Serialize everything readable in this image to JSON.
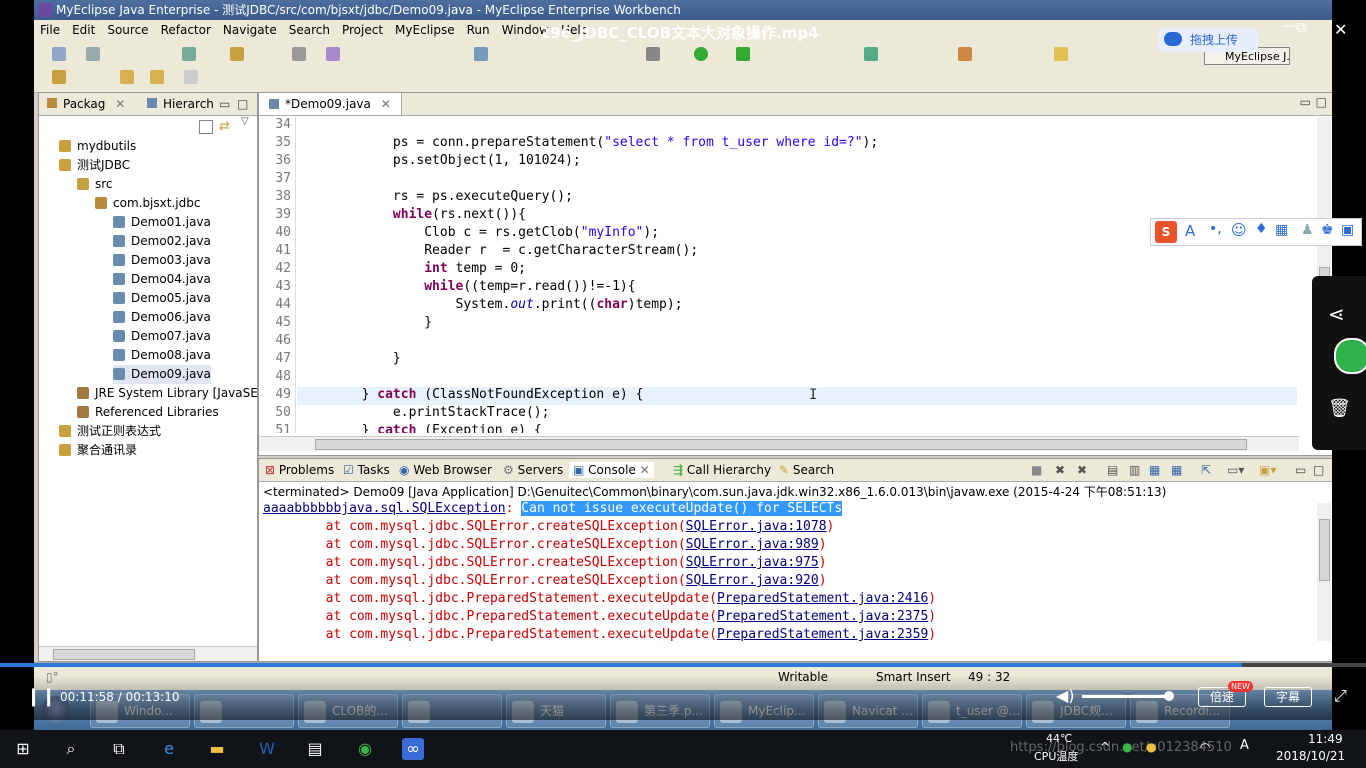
{
  "video": {
    "title": "296_JDBC_CLOB文本大对象操作.mp4",
    "upload_label": "拖拽上传",
    "current_time": "00:11:58",
    "total_time": "00:13:10",
    "time_separator": " / ",
    "progress": 0.909,
    "speed_label": "倍速",
    "speed_badge": "NEW",
    "subtitle_label": "字幕"
  },
  "ide": {
    "window_title": "MyEclipse Java Enterprise - 测试JDBC/src/com/bjsxt/jdbc/Demo09.java - MyEclipse Enterprise Workbench",
    "menus": [
      "File",
      "Edit",
      "Source",
      "Refactor",
      "Navigate",
      "Search",
      "Project",
      "MyEclipse",
      "Run",
      "Window",
      "Help"
    ],
    "perspective_label": "MyEclipse J...",
    "package_explorer": {
      "tab1": "Packag",
      "tab2": "Hierarch",
      "items": [
        {
          "label": "mydbutils",
          "level": 0,
          "icon": "project"
        },
        {
          "label": "测试JDBC",
          "level": 0,
          "icon": "project"
        },
        {
          "label": "src",
          "level": 1,
          "icon": "folder"
        },
        {
          "label": "com.bjsxt.jdbc",
          "level": 2,
          "icon": "package"
        },
        {
          "label": "Demo01.java",
          "level": 3,
          "icon": "java"
        },
        {
          "label": "Demo02.java",
          "level": 3,
          "icon": "java"
        },
        {
          "label": "Demo03.java",
          "level": 3,
          "icon": "java"
        },
        {
          "label": "Demo04.java",
          "level": 3,
          "icon": "java"
        },
        {
          "label": "Demo05.java",
          "level": 3,
          "icon": "java"
        },
        {
          "label": "Demo06.java",
          "level": 3,
          "icon": "java"
        },
        {
          "label": "Demo07.java",
          "level": 3,
          "icon": "java"
        },
        {
          "label": "Demo08.java",
          "level": 3,
          "icon": "java"
        },
        {
          "label": "Demo09.java",
          "level": 3,
          "icon": "java",
          "selected": true
        },
        {
          "label": "JRE System Library [JavaSE-",
          "level": 1,
          "icon": "library"
        },
        {
          "label": "Referenced Libraries",
          "level": 1,
          "icon": "library"
        },
        {
          "label": "测试正则表达式",
          "level": 0,
          "icon": "project"
        },
        {
          "label": "聚合通讯录",
          "level": 0,
          "icon": "project"
        }
      ]
    },
    "editor": {
      "tab_label": "*Demo09.java",
      "lines": [
        {
          "n": "34",
          "code": ""
        },
        {
          "n": "35",
          "code": "            ps = conn.prepareStatement(\"select * from t_user where id=?\");"
        },
        {
          "n": "36",
          "code": "            ps.setObject(1, 101024);"
        },
        {
          "n": "37",
          "code": ""
        },
        {
          "n": "38",
          "code": "            rs = ps.executeQuery();"
        },
        {
          "n": "39",
          "code": "            while(rs.next()){"
        },
        {
          "n": "40",
          "code": "                Clob c = rs.getClob(\"myInfo\");"
        },
        {
          "n": "41",
          "code": "                Reader r  = c.getCharacterStream();"
        },
        {
          "n": "42",
          "code": "                int temp = 0;"
        },
        {
          "n": "43",
          "code": "                while((temp=r.read())!=-1){"
        },
        {
          "n": "44",
          "code": "                    System.out.print((char)temp);"
        },
        {
          "n": "45",
          "code": "                }"
        },
        {
          "n": "46",
          "code": ""
        },
        {
          "n": "47",
          "code": "            }"
        },
        {
          "n": "48",
          "code": ""
        },
        {
          "n": "49",
          "code": "        } catch (ClassNotFoundException e) {"
        },
        {
          "n": "50",
          "code": "            e.printStackTrace();"
        },
        {
          "n": "51",
          "code": "        } catch (Exception e) {"
        }
      ]
    },
    "console": {
      "tabs": [
        "Problems",
        "Tasks",
        "Web Browser",
        "Servers",
        "Console",
        "Call Hierarchy",
        "Search"
      ],
      "status": "<terminated> Demo09 [Java Application] D:\\Genuitec\\Common\\binary\\com.sun.java.jdk.win32.x86_1.6.0.013\\bin\\javaw.exe (2015-4-24 下午08:51:13)",
      "exception_prefix": "aaaabbbbbbjava.sql.SQLException",
      "exception_sep": ": ",
      "exception_msg": "Can not issue executeUpdate() for SELECTs",
      "trace": [
        {
          "at": "        at com.mysql.jdbc.SQLError.createSQLException(",
          "link": "SQLError.java:1078",
          "end": ")"
        },
        {
          "at": "        at com.mysql.jdbc.SQLError.createSQLException(",
          "link": "SQLError.java:989",
          "end": ")"
        },
        {
          "at": "        at com.mysql.jdbc.SQLError.createSQLException(",
          "link": "SQLError.java:975",
          "end": ")"
        },
        {
          "at": "        at com.mysql.jdbc.SQLError.createSQLException(",
          "link": "SQLError.java:920",
          "end": ")"
        },
        {
          "at": "        at com.mysql.jdbc.PreparedStatement.executeUpdate(",
          "link": "PreparedStatement.java:2416",
          "end": ")"
        },
        {
          "at": "        at com.mysql.jdbc.PreparedStatement.executeUpdate(",
          "link": "PreparedStatement.java:2375",
          "end": ")"
        },
        {
          "at": "        at com.mysql.jdbc.PreparedStatement.executeUpdate(",
          "link": "PreparedStatement.java:2359",
          "end": ")"
        }
      ]
    },
    "statusbar": {
      "writable": "Writable",
      "insert_mode": "Smart Insert",
      "position": "49 : 32"
    }
  },
  "win7_taskbar": [
    {
      "label": "Windo..."
    },
    {
      "label": ""
    },
    {
      "label": "CLOB的..."
    },
    {
      "label": ""
    },
    {
      "label": "天猫"
    },
    {
      "label": "第三季.p..."
    },
    {
      "label": "MyEclip..."
    },
    {
      "label": "Navicat ..."
    },
    {
      "label": "t_user @..."
    },
    {
      "label": "JDBC规..."
    },
    {
      "label": "Recordi..."
    }
  ],
  "win10_taskbar": {
    "temperature": "44℃",
    "temp_label": "CPU温度",
    "clock_time": "11:49",
    "clock_date": "2018/10/21",
    "watermark": "https://blog.csdn.net/u012384510"
  },
  "colors": {
    "progress": "#2a7bd8",
    "keyword": "#7f0055",
    "string": "#2a00ff",
    "error": "#cc0000"
  }
}
